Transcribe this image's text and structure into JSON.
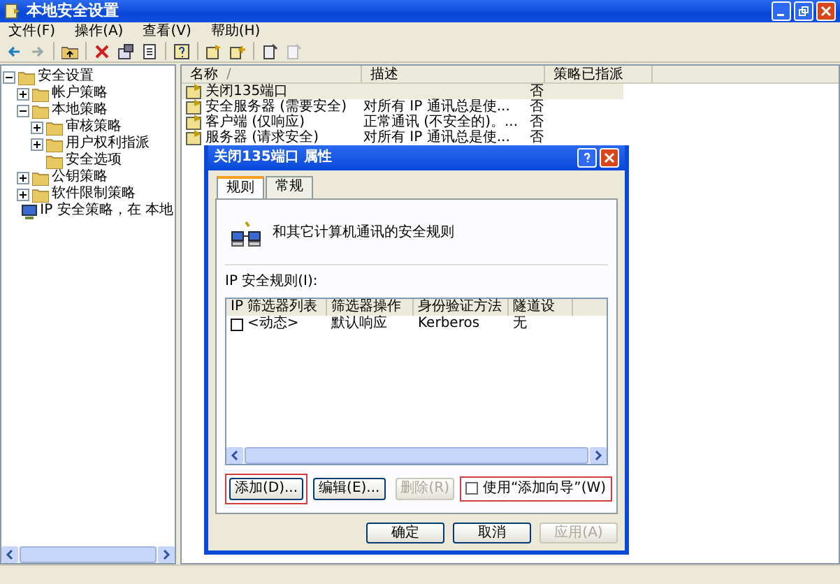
{
  "window": {
    "title": "本地安全设置"
  },
  "menu": [
    "文件(F)",
    "操作(A)",
    "查看(V)",
    "帮助(H)"
  ],
  "tree": [
    {
      "label": "安全设置",
      "expanded": true,
      "children": [
        {
          "label": "帐户策略",
          "expanded": false
        },
        {
          "label": "本地策略",
          "expanded": true,
          "children": [
            {
              "label": "审核策略",
              "expanded": false
            },
            {
              "label": "用户权利指派",
              "expanded": false
            },
            {
              "label": "安全选项"
            }
          ]
        },
        {
          "label": "公钥策略",
          "expanded": false
        },
        {
          "label": "软件限制策略",
          "expanded": false
        },
        {
          "label": "IP 安全策略，在 本地",
          "kind": "network"
        }
      ]
    }
  ],
  "list": {
    "columns": [
      "名称",
      "描述",
      "策略已指派"
    ],
    "sort_mark": "/",
    "rows": [
      {
        "name": "关闭135端口",
        "description": "",
        "assigned": "否",
        "selected": true
      },
      {
        "name": "安全服务器 (需要安全)",
        "description": "对所有 IP 通讯总是使...",
        "assigned": "否",
        "selected": false
      },
      {
        "name": "客户端 (仅响应)",
        "description": "正常通讯 (不安全的)。...",
        "assigned": "否",
        "selected": false
      },
      {
        "name": "服务器 (请求安全)",
        "description": "对所有 IP 通讯总是使...",
        "assigned": "否",
        "selected": false
      }
    ]
  },
  "dialog": {
    "title": "关闭135端口 属性",
    "tabs": [
      {
        "label": "规则",
        "selected": true
      },
      {
        "label": "常规",
        "selected": false
      }
    ],
    "heading": "和其它计算机通讯的安全规则",
    "rules_label": "IP 安全规则(I):",
    "rules": {
      "columns": [
        "IP 筛选器列表",
        "筛选器操作",
        "身份验证方法",
        "隧道设"
      ],
      "rows": [
        {
          "checked": false,
          "cells": [
            "<动态>",
            "默认响应",
            "Kerberos",
            "无"
          ]
        }
      ]
    },
    "buttons": [
      {
        "label": "添加(D)...",
        "disabled": false,
        "highlighted": true
      },
      {
        "label": "编辑(E)...",
        "disabled": false,
        "highlighted": false
      },
      {
        "label": "删除(R)",
        "disabled": true,
        "highlighted": false
      }
    ],
    "wizard": {
      "label": "使用“添加向导”(W)",
      "checked": false,
      "highlighted": true
    },
    "footer": [
      {
        "label": "确定",
        "disabled": false
      },
      {
        "label": "取消",
        "disabled": false
      },
      {
        "label": "应用(A)",
        "disabled": true
      }
    ]
  }
}
